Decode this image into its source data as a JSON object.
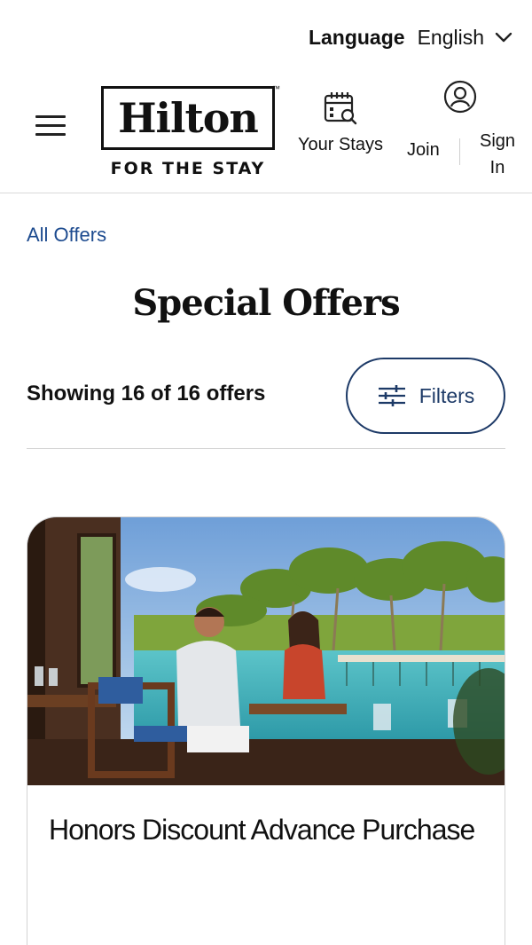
{
  "language": {
    "label": "Language",
    "value": "English",
    "icon": "chevron-down-icon"
  },
  "header": {
    "menu_icon": "hamburger-menu-icon",
    "logo": {
      "word": "Hilton",
      "tagline": "FOR THE STAY",
      "tm": "™"
    },
    "nav": {
      "stays_label": "Your Stays",
      "stays_icon": "calendar-search-icon",
      "join_label": "Join",
      "signin_label_1": "Sign",
      "signin_label_2": "In",
      "signin_icon": "user-circle-icon"
    }
  },
  "breadcrumb": {
    "label": "All Offers"
  },
  "page": {
    "title": "Special Offers",
    "count_text": "Showing 16 of 16 offers",
    "filters_label": "Filters",
    "filters_icon": "sliders-icon"
  },
  "offers": [
    {
      "title": "Honors Discount Advance Purchase",
      "image": "resort-dining-photo"
    }
  ],
  "colors": {
    "link": "#1d4b8f",
    "button_border": "#1d3a67",
    "text": "#111111"
  }
}
